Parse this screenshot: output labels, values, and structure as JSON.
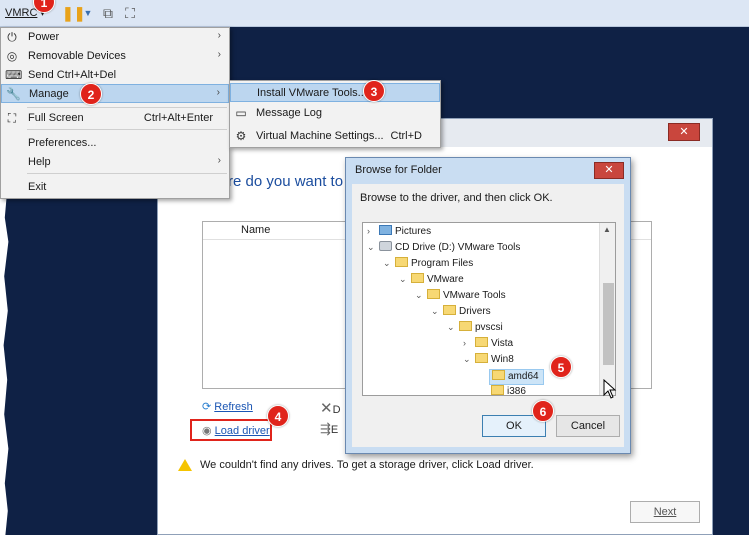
{
  "toolbar": {
    "vmrc_label": "VMRC",
    "icons": [
      "pause-icon",
      "dropdown-icon",
      "network-icon",
      "fullscreen-icon"
    ]
  },
  "callouts": [
    "1",
    "2",
    "3",
    "4",
    "5",
    "6"
  ],
  "vmrc_menu": {
    "items": [
      {
        "label": "Power",
        "icon": "power-icon",
        "submenu": true
      },
      {
        "label": "Removable Devices",
        "icon": "removable-icon",
        "submenu": true
      },
      {
        "label": "Send Ctrl+Alt+Del",
        "icon": "keyboard-icon",
        "submenu": false
      },
      {
        "label": "Manage",
        "icon": "wrench-icon",
        "submenu": true,
        "highlighted": true
      },
      {
        "label": "Full Screen",
        "shortcut": "Ctrl+Alt+Enter",
        "icon": "fullscreen-icon"
      },
      {
        "label": "Preferences..."
      },
      {
        "label": "Help",
        "submenu": true
      },
      {
        "label": "Exit"
      }
    ]
  },
  "manage_submenu": {
    "items": [
      {
        "label": "Install VMware Tools...",
        "highlighted": true
      },
      {
        "label": "Message Log",
        "icon": "log-icon"
      },
      {
        "label": "Virtual Machine Settings...",
        "shortcut": "Ctrl+D",
        "icon": "settings-icon"
      }
    ]
  },
  "setup_dialog": {
    "heading": "re do you want to ir",
    "column_name": "Name",
    "refresh": "Refresh",
    "load_driver": "Load driver",
    "warning": "We couldn't find any drives. To get a storage driver, click Load driver.",
    "next": "Next",
    "partial_d": "D",
    "partial_e": "E"
  },
  "browse_dialog": {
    "title": "Browse for Folder",
    "prompt": "Browse to the driver, and then click OK.",
    "tree": [
      {
        "label": "Pictures",
        "level": 0,
        "expander": ">",
        "type": "pictures"
      },
      {
        "label": "CD Drive (D:) VMware Tools",
        "level": 0,
        "expander": "v",
        "type": "drive"
      },
      {
        "label": "Program Files",
        "level": 1,
        "expander": "v",
        "type": "folder"
      },
      {
        "label": "VMware",
        "level": 2,
        "expander": "v",
        "type": "folder"
      },
      {
        "label": "VMware Tools",
        "level": 3,
        "expander": "v",
        "type": "folder"
      },
      {
        "label": "Drivers",
        "level": 4,
        "expander": "v",
        "type": "folder"
      },
      {
        "label": "pvscsi",
        "level": 5,
        "expander": "v",
        "type": "folder"
      },
      {
        "label": "Vista",
        "level": 6,
        "expander": ">",
        "type": "folder"
      },
      {
        "label": "Win8",
        "level": 6,
        "expander": "v",
        "type": "folder"
      },
      {
        "label": "amd64",
        "level": 7,
        "expander": "",
        "type": "folder",
        "selected": true
      },
      {
        "label": "i386",
        "level": 7,
        "expander": "",
        "type": "folder"
      }
    ],
    "ok": "OK",
    "cancel": "Cancel"
  },
  "colors": {
    "accent_red": "#e0241b",
    "menu_highlight": "#bcd6ef",
    "link_blue": "#1a55b3",
    "desktop": "#0f2145"
  }
}
